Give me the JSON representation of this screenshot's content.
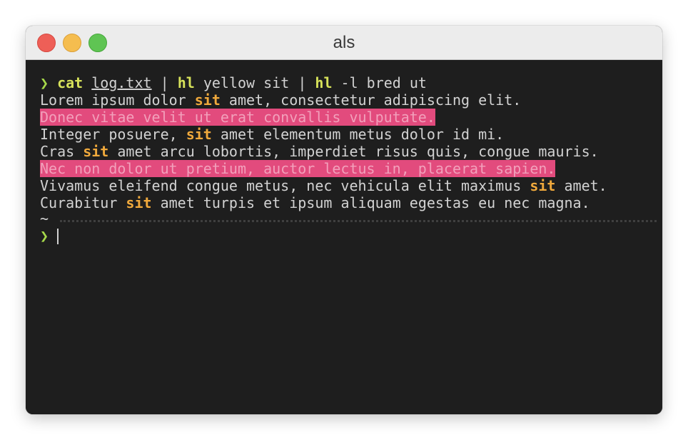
{
  "window": {
    "title": "als"
  },
  "terminal": {
    "prompt_symbol": "❯",
    "command": {
      "cat": "cat",
      "file": "log.txt",
      "pipe1": "|",
      "hl1": "hl",
      "hl1_args": "yellow sit",
      "pipe2": "|",
      "hl2": "hl",
      "hl2_args": "-l bred ut"
    },
    "lines": [
      {
        "before": "Lorem ipsum dolor ",
        "match": "sit",
        "after": " amet, consectetur adipiscing elit."
      },
      {
        "full": "Donec vitae velit ut erat convallis vulputate."
      },
      {
        "before": "Integer posuere, ",
        "match": "sit",
        "after": " amet elementum metus dolor id mi."
      },
      {
        "before": "Cras ",
        "match": "sit",
        "after": " amet arcu lobortis, imperdiet risus quis, congue mauris."
      },
      {
        "full": "Nec non dolor ut pretium, auctor lectus in, placerat sapien."
      },
      {
        "before": "Vivamus eleifend congue metus, nec vehicula elit maximus ",
        "match": "sit",
        "after": " amet."
      },
      {
        "before": "Curabitur ",
        "match": "sit",
        "after": " amet turpis et ipsum aliquam egestas eu nec magna."
      }
    ],
    "tilde": "~",
    "colors": {
      "background": "#1e1e1e",
      "prompt": "#a6d84a",
      "command": "#d6e15a",
      "match_yellow": "#f0a93c",
      "highlight_line_bg": "#e24b7d"
    }
  }
}
